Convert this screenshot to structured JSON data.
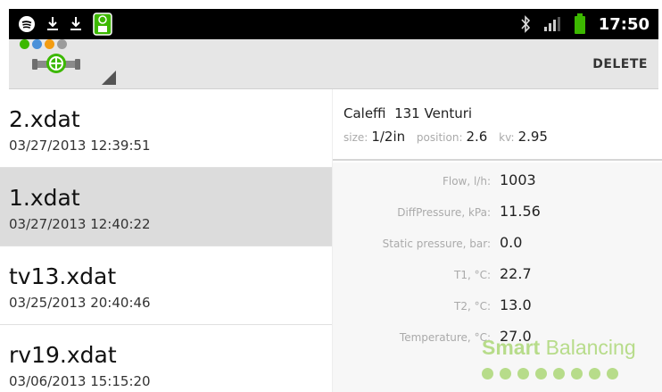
{
  "status_bar": {
    "time": "17:50",
    "icons": [
      "spotify-icon",
      "download-icon",
      "download-icon",
      "app-badge-icon",
      "bluetooth-icon",
      "signal-icon",
      "battery-icon"
    ],
    "battery_color": "#3cb800"
  },
  "action_bar": {
    "app_icon": "valve-logo",
    "brand_dot_colors": [
      "#3cb800",
      "#4a90d9",
      "#f39c12",
      "#9b9b9b"
    ],
    "delete_label": "DELETE"
  },
  "files": [
    {
      "name": "2.xdat",
      "date": "03/27/2013 12:39:51",
      "selected": false
    },
    {
      "name": "1.xdat",
      "date": "03/27/2013 12:40:22",
      "selected": true
    },
    {
      "name": "tv13.xdat",
      "date": "03/25/2013 20:40:46",
      "selected": false
    },
    {
      "name": "rv19.xdat",
      "date": "03/06/2013 15:15:20",
      "selected": false
    }
  ],
  "detail": {
    "valve_name": "Caleffi  131 Venturi",
    "size_label": "size:",
    "size_value": "1/2in",
    "position_label": "position:",
    "position_value": "2.6",
    "kv_label": "kv:",
    "kv_value": "2.95",
    "measurements": [
      {
        "label": "Flow, l/h:",
        "value": "1003"
      },
      {
        "label": "DiffPressure, kPa:",
        "value": "11.56"
      },
      {
        "label": "Static pressure, bar:",
        "value": "0.0"
      },
      {
        "label": "T1, °C:",
        "value": "22.7"
      },
      {
        "label": "T2, °C:",
        "value": "13.0"
      },
      {
        "label": "Temperature, °C:",
        "value": "27.0"
      }
    ]
  },
  "watermark": {
    "brand_bold": "Smart",
    "brand_rest": " Balancing",
    "color": "#b7dc8a"
  }
}
